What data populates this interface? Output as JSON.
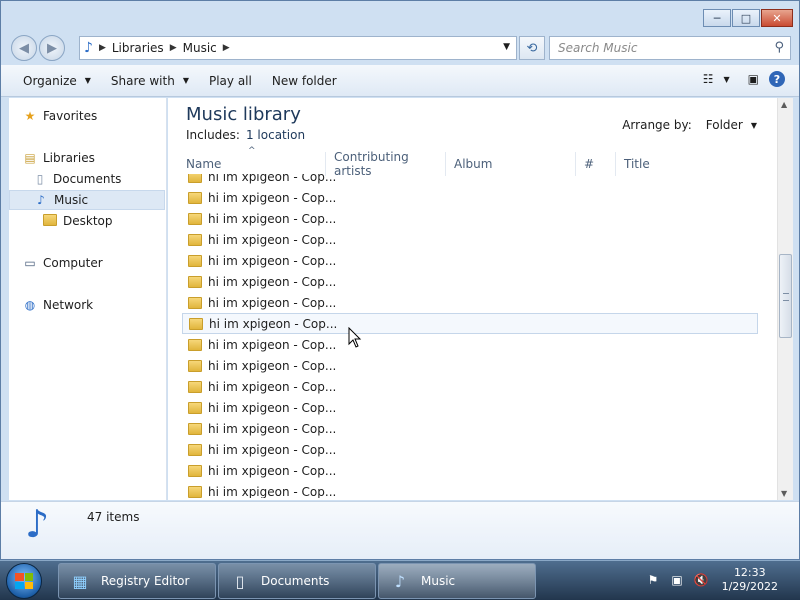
{
  "window": {
    "controls": {
      "minimize": "─",
      "maximize": "□",
      "close": "✕"
    }
  },
  "navbar": {
    "breadcrumbs": [
      "Libraries",
      "Music"
    ],
    "search_placeholder": "Search Music"
  },
  "toolbar": {
    "organize": "Organize",
    "share_with": "Share with",
    "play_all": "Play all",
    "new_folder": "New folder"
  },
  "sidebar": {
    "favorites": "Favorites",
    "libraries": "Libraries",
    "documents": "Documents",
    "music": "Music",
    "desktop": "Desktop",
    "computer": "Computer",
    "network": "Network"
  },
  "main": {
    "title": "Music library",
    "includes_label": "Includes:",
    "includes_link": "1 location",
    "arrange_label": "Arrange by:",
    "arrange_value": "Folder",
    "columns": [
      "Name",
      "Contributing artists",
      "Album",
      "#",
      "Title"
    ],
    "rows": [
      "hi im xpigeon - Cop...",
      "hi im xpigeon - Cop...",
      "hi im xpigeon - Cop...",
      "hi im xpigeon - Cop...",
      "hi im xpigeon - Cop...",
      "hi im xpigeon - Cop...",
      "hi im xpigeon - Cop...",
      "hi im xpigeon - Cop...",
      "hi im xpigeon - Cop...",
      "hi im xpigeon - Cop...",
      "hi im xpigeon - Cop...",
      "hi im xpigeon - Cop...",
      "hi im xpigeon - Cop...",
      "hi im xpigeon - Cop...",
      "hi im xpigeon - Cop...",
      "hi im xpigeon - Cop..."
    ]
  },
  "details": {
    "count": "47 items"
  },
  "taskbar": {
    "tasks": [
      "Registry Editor",
      "Documents",
      "Music"
    ],
    "time": "12:33",
    "date": "1/29/2022"
  },
  "colors": {
    "accent": "#1e395b",
    "taskbar": "#22364d",
    "selection": "#dde8f5"
  }
}
